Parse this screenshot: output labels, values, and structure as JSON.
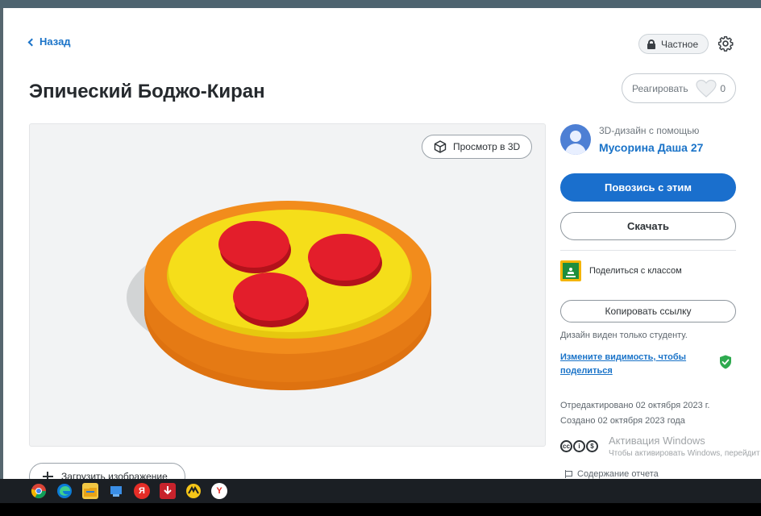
{
  "nav": {
    "back_label": "Назад"
  },
  "privacy": {
    "label": "Частное"
  },
  "design": {
    "title": "Эпический Боджо-Киран"
  },
  "reaction": {
    "label": "Реагировать",
    "count": "0"
  },
  "viewer": {
    "view3d_label": "Просмотр в 3D"
  },
  "upload": {
    "label": "Загрузить изображение"
  },
  "creator": {
    "by_label": "3D-дизайн с помощью",
    "name": "Мусорина Даша 27"
  },
  "actions": {
    "tinker_label": "Повозись с этим",
    "download_label": "Скачать",
    "share_class_label": "Поделиться с классом",
    "copy_link_label": "Копировать ссылку"
  },
  "visibility": {
    "note": "Дизайн виден только студенту.",
    "change_link": "Измените видимость, чтобы поделиться"
  },
  "meta": {
    "edited": "Отредактировано 02 октября 2023 г.",
    "created": "Создано 02 октября 2023 года",
    "license_icons": [
      "cc",
      "by",
      "nc"
    ]
  },
  "report": {
    "label": "Содержание отчета"
  },
  "watermark": {
    "line1": "Активация Windows",
    "line2": "Чтобы активировать Windows, перейдит"
  },
  "taskbar": {
    "icons": [
      "chrome-icon",
      "edge-icon",
      "file-explorer-icon",
      "app-icon",
      "yandex-icon",
      "download-icon",
      "app-icon",
      "yandex-browser-icon"
    ]
  },
  "colors": {
    "accent": "#1a6fcd",
    "link": "#1a73c8",
    "pizza_crust": "#f28c1c",
    "pizza_cheese": "#f5de1a",
    "pizza_pepperoni": "#e31e2b"
  }
}
